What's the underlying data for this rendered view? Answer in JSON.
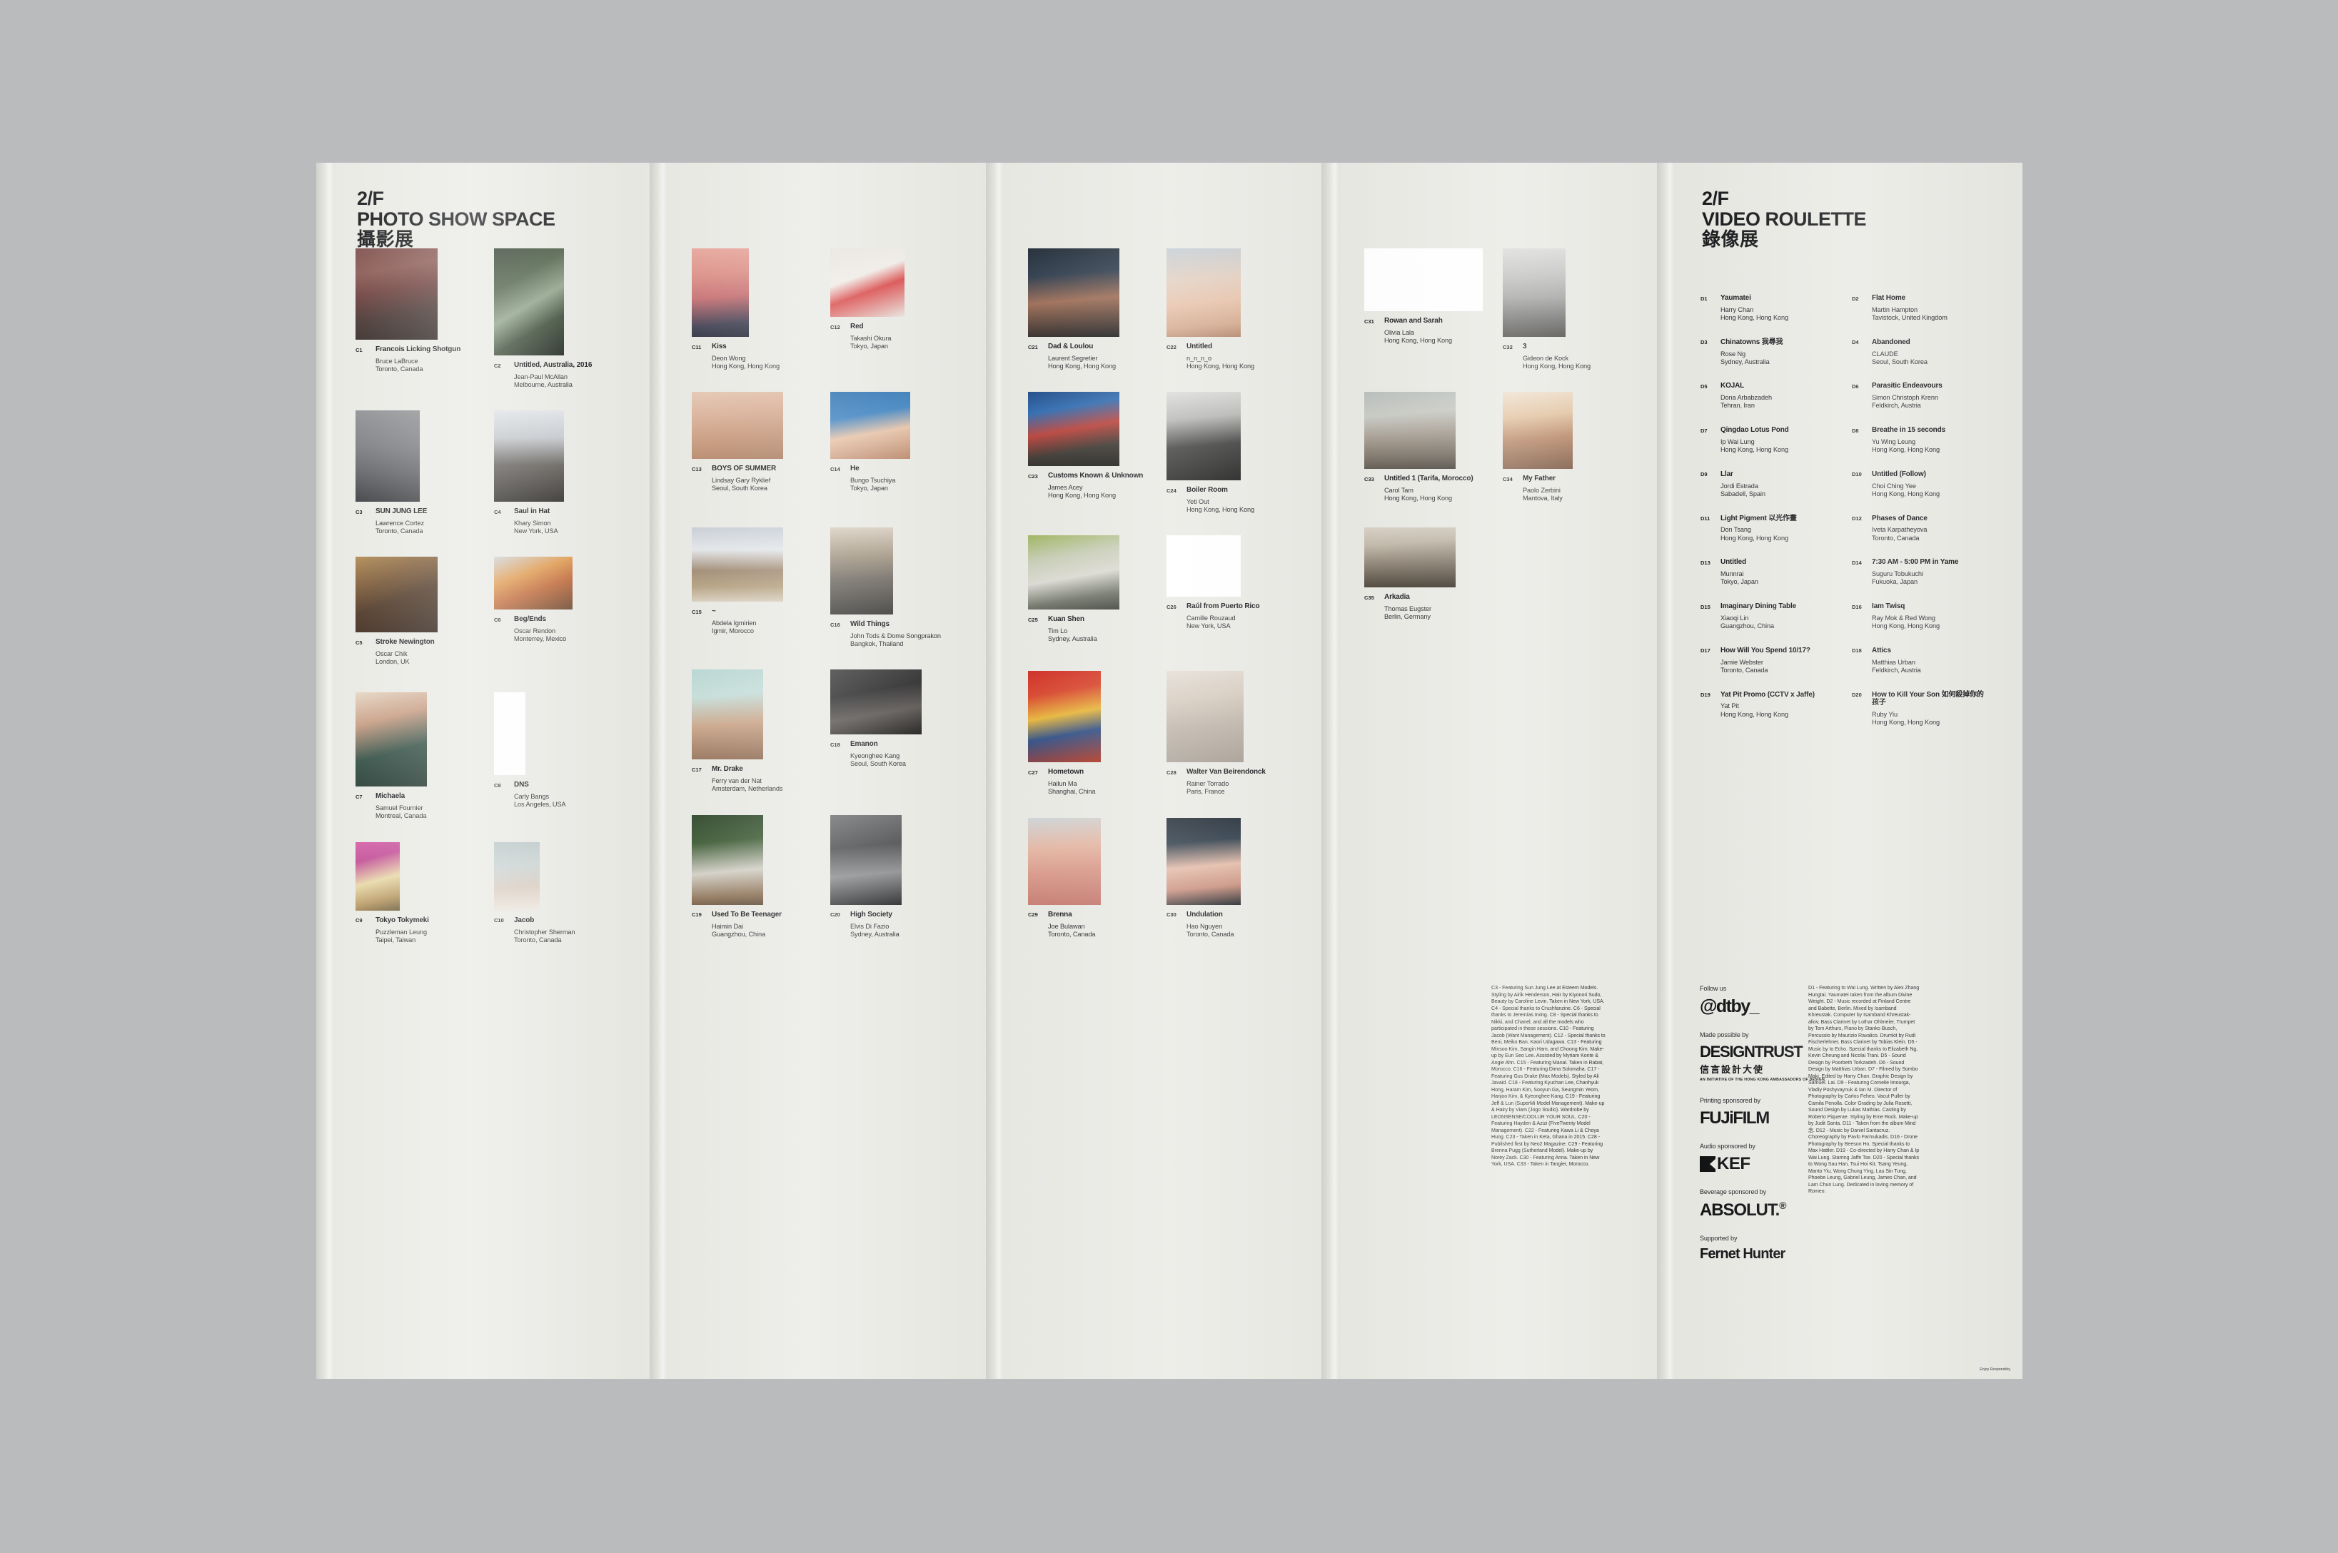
{
  "photo_panel": {
    "floor": "2/F",
    "title": "PHOTO SHOW SPACE",
    "title_cjk": "攝影展"
  },
  "video_panel": {
    "floor": "2/F",
    "title": "VIDEO ROULETTE",
    "title_cjk": "錄像展"
  },
  "photo_works": [
    {
      "code": "C1",
      "title": "Francois Licking Shotgun",
      "artist": "Bruce LaBruce",
      "place": "Toronto, Canada",
      "w": 115,
      "h": 128,
      "img": "linear-gradient(170deg,#7c4e4a 0%,#8a5852 25%,#6d3f3c 45%,#44332f 70%,#2c2422 100%)"
    },
    {
      "code": "C2",
      "title": "Untitled, Australia, 2016",
      "artist": "Jean-Paul McAllan",
      "place": "Melbourne, Australia",
      "w": 98,
      "h": 150,
      "img": "linear-gradient(150deg,#2d3a2a 0%,#4d6047 30%,#8fa289 52%,#3a4a36 72%,#18201a 100%)"
    },
    {
      "code": "C3",
      "title": "SUN JUNG LEE",
      "artist": "Lawrence Cortez",
      "place": "Toronto, Canada",
      "w": 90,
      "h": 128,
      "img": "linear-gradient(180deg,#8e9093 0%,#7a7c80 40%,#5e6064 70%,#3b3d40 100%)"
    },
    {
      "code": "C4",
      "title": "Saul in Hat",
      "artist": "Khary Simon",
      "place": "New York, USA",
      "w": 98,
      "h": 128,
      "img": "linear-gradient(180deg,#dfe2e6 0%,#c2c6ca 30%,#5f5b57 60%,#2a2824 100%)"
    },
    {
      "code": "C5",
      "title": "Stroke Newington",
      "artist": "Oscar Chik",
      "place": "London, UK",
      "w": 115,
      "h": 106,
      "img": "linear-gradient(160deg,#b08a52 0%,#7f5c38 28%,#4c3523 55%,#2b1d14 100%)"
    },
    {
      "code": "C6",
      "title": "Beg/Ends",
      "artist": "Oscar Rendon",
      "place": "Monterrey, Mexico",
      "w": 110,
      "h": 74,
      "img": "linear-gradient(160deg,#cfd3d6 0%,#e09a4e 35%,#c06a3a 60%,#6d4a33 100%)"
    },
    {
      "code": "C7",
      "title": "Michaela",
      "artist": "Samuel Fournier",
      "place": "Montreal, Canada",
      "w": 100,
      "h": 132,
      "img": "linear-gradient(165deg,#e5d7c4 0%,#c79c82 30%,#2f4d43 62%,#1d3029 100%)"
    },
    {
      "code": "C8",
      "title": "DNS",
      "artist": "Carly Bangs",
      "place": "Los Angeles, USA",
      "w": 44,
      "h": 116,
      "img": "linear-gradient(180deg,#ffffff 0%,#ffffff 100%)"
    },
    {
      "code": "C9",
      "title": "Tokyo Tokymeki",
      "artist": "Puzzleman Leung",
      "place": "Taipei, Taiwan",
      "w": 62,
      "h": 96,
      "img": "linear-gradient(165deg,#d45fa8 0%,#c24e96 25%,#e8d9a8 55%,#b89a64 80%,#6b5c3a 100%)"
    },
    {
      "code": "C10",
      "title": "Jacob",
      "artist": "Christopher Sherman",
      "place": "Toronto, Canada",
      "w": 64,
      "h": 96,
      "img": "linear-gradient(175deg,#b9c5c6 0%,#c9d2d2 35%,#d9ccc0 65%,#efe9e2 100%)"
    },
    {
      "code": "C11",
      "title": "Kiss",
      "artist": "Deon Wong",
      "place": "Hong Kong, Hong Kong",
      "w": 80,
      "h": 124,
      "img": "linear-gradient(175deg,#e8a79c 0%,#dc8f86 30%,#c66f72 55%,#3e3f52 85%,#2b2c3a 100%)"
    },
    {
      "code": "C12",
      "title": "Red",
      "artist": "Takashi Okura",
      "place": "Tokyo, Japan",
      "w": 104,
      "h": 96,
      "img": "linear-gradient(160deg,#e7e3dd 0%,#f0ece6 40%,#d94a4a 60%,#e9e5df 100%)"
    },
    {
      "code": "C13",
      "title": "BOYS OF SUMMER",
      "artist": "Lindsay Gary Ryklief",
      "place": "Seoul, South Korea",
      "w": 128,
      "h": 94,
      "img": "linear-gradient(170deg,#e6c9b4 0%,#d9ae95 35%,#c59678 65%,#a87a5e 100%)"
    },
    {
      "code": "C14",
      "title": "He",
      "artist": "Bungo Tsuchiya",
      "place": "Tokyo, Japan",
      "w": 112,
      "h": 94,
      "img": "linear-gradient(170deg,#2b6fae 0%,#3c82c0 35%,#e7c3a8 60%,#b98668 100%)"
    },
    {
      "code": "C15",
      "title": "~",
      "artist": "Abdela Igmirien",
      "place": "Igmir, Morocco",
      "w": 128,
      "h": 104,
      "img": "linear-gradient(180deg,#c8ced5 0%,#e3e6e9 30%,#9f8a72 58%,#b4a07f 80%,#d9cfbe 100%)"
    },
    {
      "code": "C16",
      "title": "Wild Things",
      "artist": "John Tods & Dome Songprakon",
      "place": "Bangkok, Thailand",
      "w": 88,
      "h": 122,
      "img": "linear-gradient(180deg,#d8cec0 0%,#a89b88 30%,#6f6a62 60%,#3b3a38 100%)"
    },
    {
      "code": "C17",
      "title": "Mr. Drake",
      "artist": "Ferry van der Nat",
      "place": "Amsterdam, Netherlands",
      "w": 100,
      "h": 126,
      "img": "linear-gradient(175deg,#b7d6d2 0%,#c5ded9 30%,#caa588 60%,#8e6a52 100%)"
    },
    {
      "code": "C18",
      "title": "Emanon",
      "artist": "Kyeonghee Kang",
      "place": "Seoul, South Korea",
      "w": 128,
      "h": 91,
      "img": "linear-gradient(170deg,#3b3b3c 0%,#2a2a2b 35%,#5a5552 65%,#1a1918 100%)"
    },
    {
      "code": "C19",
      "title": "Used To Be Teenager",
      "artist": "Haimin Dai",
      "place": "Guangzhou, China",
      "w": 100,
      "h": 126,
      "img": "linear-gradient(175deg,#2c4428 0%,#3c5a33 30%,#d3d0c6 62%,#8d7256 88%,#5c4a36 100%)"
    },
    {
      "code": "C20",
      "title": "High Society",
      "artist": "Elvis Di Fazio",
      "place": "Sydney, Australia",
      "w": 100,
      "h": 126,
      "img": "linear-gradient(175deg,#6d6f70 0%,#4a4c4d 35%,#8c8e8f 65%,#222324 100%)"
    },
    {
      "code": "C21",
      "title": "Dad & Loulou",
      "artist": "Laurent Segretier",
      "place": "Hong Kong, Hong Kong",
      "w": 128,
      "h": 124,
      "img": "linear-gradient(175deg,#1f2a36 0%,#2e3c4c 30%,#9d6d56 58%,#4a3a33 85%,#1b1c1e 100%)"
    },
    {
      "code": "C22",
      "title": "Untitled",
      "artist": "n_n_n_o",
      "place": "Hong Kong, Hong Kong",
      "w": 104,
      "h": 124,
      "img": "linear-gradient(175deg,#c3cdd4 0%,#e2cfc0 35%,#e7c3ab 60%,#d4a98e 85%,#b3866c 100%)"
    },
    {
      "code": "C23",
      "title": "Customs Known & Unknown",
      "artist": "James Acey",
      "place": "Hong Kong, Hong Kong",
      "w": 128,
      "h": 104,
      "img": "linear-gradient(170deg,#1e4a86 0%,#2f6bb0 25%,#b9423a 50%,#3a3630 75%,#1a1a18 100%)"
    },
    {
      "code": "C24",
      "title": "Boiler Room",
      "artist": "Yeti Out",
      "place": "Hong Kong, Hong Kong",
      "w": 104,
      "h": 124,
      "img": "linear-gradient(175deg,#dcdcda 0%,#b6b6b4 30%,#3f3f3e 60%,#1d1d1c 100%)"
    },
    {
      "code": "C25",
      "title": "Kuan Shen",
      "artist": "Tim Lo",
      "place": "Sydney, Australia",
      "w": 128,
      "h": 104,
      "img": "linear-gradient(170deg,#9fb45f 0%,#c7cdb6 30%,#dcdad2 55%,#6f7468 80%,#3a3d36 100%)"
    },
    {
      "code": "C26",
      "title": "Raúl from Puerto Rico",
      "artist": "Camille Rouzaud",
      "place": "New York, USA",
      "w": 104,
      "h": 86,
      "img": "linear-gradient(180deg,#ffffff 0%,#ffffff 100%)"
    },
    {
      "code": "C27",
      "title": "Hometown",
      "artist": "Hailun Ma",
      "place": "Shanghai, China",
      "w": 102,
      "h": 128,
      "img": "linear-gradient(170deg,#cf2b22 0%,#d8452c 25%,#e8b63a 48%,#2f4f86 68%,#b1351f 100%)"
    },
    {
      "code": "C28",
      "title": "Walter Van Beirendonck",
      "artist": "Rainer Torrado",
      "place": "Paris, France",
      "w": 108,
      "h": 128,
      "img": "linear-gradient(175deg,#e3dcd3 0%,#d6cbbf 30%,#bdb3a8 60%,#a69d93 100%)"
    },
    {
      "code": "C29",
      "title": "Brenna",
      "artist": "Joe Bulawan",
      "place": "Toronto, Canada",
      "w": 102,
      "h": 122,
      "img": "linear-gradient(175deg,#cfd6d8 0%,#e5b6a2 35%,#d99a8a 60%,#c4766c 100%)"
    },
    {
      "code": "C30",
      "title": "Undulation",
      "artist": "Hao Nguyen",
      "place": "Toronto, Canada",
      "w": 104,
      "h": 122,
      "img": "linear-gradient(175deg,#1e2630 0%,#2c3a47 28%,#e3bba8 55%,#c9907e 78%,#1f262d 100%)"
    },
    {
      "code": "C31",
      "title": "Rowan and Sarah",
      "artist": "Olivia Lala",
      "place": "Hong Kong, Hong Kong",
      "w": 166,
      "h": 88,
      "img": "linear-gradient(180deg,#ffffff 0%,#ffffff 100%)"
    },
    {
      "code": "C32",
      "title": "3",
      "artist": "Gideon de Kock",
      "place": "Hong Kong, Hong Kong",
      "w": 88,
      "h": 124,
      "img": "linear-gradient(180deg,#dcdcdb 0%,#c4c4c3 30%,#a8a8a7 55%,#6e6e6d 85%,#55534f 100%)"
    },
    {
      "code": "C33",
      "title": "Untitled 1 (Tarifa, Morocco)",
      "artist": "Carol Tam",
      "place": "Hong Kong, Hong Kong",
      "w": 128,
      "h": 108,
      "img": "linear-gradient(175deg,#b9bfbd 0%,#c9cac4 30%,#a39a8e 58%,#776f64 82%,#4b463f 100%)"
    },
    {
      "code": "C34",
      "title": "My Father",
      "artist": "Paolo Zerbini",
      "place": "Mantova, Italy",
      "w": 98,
      "h": 108,
      "img": "linear-gradient(175deg,#efe1cf 0%,#e3c4a2 32%,#b98a6a 60%,#7c5b46 100%)"
    },
    {
      "code": "C35",
      "title": "Arkadia",
      "artist": "Thomas Eugster",
      "place": "Berlin, Germany",
      "w": 128,
      "h": 84,
      "img": "linear-gradient(175deg,#d9d1c5 0%,#c1b8a9 28%,#8d8375 56%,#5c5347 82%,#383229 100%)"
    }
  ],
  "video_works": [
    {
      "code": "D1",
      "title": "Yaumatei",
      "artist": "Harry Chan",
      "place": "Hong Kong, Hong Kong"
    },
    {
      "code": "D2",
      "title": "Flat Home",
      "artist": "Martin Hampton",
      "place": "Tavistock, United Kingdom"
    },
    {
      "code": "D3",
      "title": "Chinatowns 我尋我",
      "artist": "Rose Ng",
      "place": "Sydney, Australia"
    },
    {
      "code": "D4",
      "title": "Abandoned",
      "artist": "CLAUDE",
      "place": "Seoul, South Korea"
    },
    {
      "code": "D5",
      "title": "KOJAL",
      "artist": "Dona Arbabzadeh",
      "place": "Tehran, Iran"
    },
    {
      "code": "D6",
      "title": "Parasitic Endeavours",
      "artist": "Simon Christoph Krenn",
      "place": "Feldkirch, Austria"
    },
    {
      "code": "D7",
      "title": "Qingdao Lotus Pond",
      "artist": "Ip Wai Lung",
      "place": "Hong Kong, Hong Kong"
    },
    {
      "code": "D8",
      "title": "Breathe in 15 seconds",
      "artist": "Yu Wing Leung",
      "place": "Hong Kong, Hong Kong"
    },
    {
      "code": "D9",
      "title": "Llar",
      "artist": "Jordi Estrada",
      "place": "Sabadell, Spain"
    },
    {
      "code": "D10",
      "title": "Untitled (Follow)",
      "artist": "Choi Ching Yee",
      "place": "Hong Kong, Hong Kong"
    },
    {
      "code": "D11",
      "title": "Light Pigment 以光作畫",
      "artist": "Don Tsang",
      "place": "Hong Kong, Hong Kong"
    },
    {
      "code": "D12",
      "title": "Phases of Dance",
      "artist": "Iveta Karpatheyova",
      "place": "Toronto, Canada"
    },
    {
      "code": "D13",
      "title": "Untitled",
      "artist": "Munnrai",
      "place": "Tokyo, Japan"
    },
    {
      "code": "D14",
      "title": "7:30 AM - 5:00 PM in Yame",
      "artist": "Suguru Tobukuchi",
      "place": "Fukuoka, Japan"
    },
    {
      "code": "D15",
      "title": "Imaginary Dining Table",
      "artist": "Xiaoqi Lin",
      "place": "Guangzhou, China"
    },
    {
      "code": "D16",
      "title": "Iam Twisq",
      "artist": "Ray Mok & Red Wong",
      "place": "Hong Kong, Hong Kong"
    },
    {
      "code": "D17",
      "title": "How Will You Spend 10/17?",
      "artist": "Jamie Webster",
      "place": "Toronto, Canada"
    },
    {
      "code": "D18",
      "title": "Attics",
      "artist": "Matthias Urban",
      "place": "Feldkirch, Austria"
    },
    {
      "code": "D19",
      "title": "Yat Pit Promo (CCTV x Jaffe)",
      "artist": "Yat Pit",
      "place": "Hong Kong, Hong Kong"
    },
    {
      "code": "D20",
      "title": "How to Kill Your Son 如何殺掉你的孩子",
      "artist": "Ruby Yiu",
      "place": "Hong Kong, Hong Kong"
    }
  ],
  "credits": {
    "photo": "C3 - Featuring Sun Jung Lee at Esteem Models. Styling by Airik Henderson, Hair by Kiyonori Sudo, Beauty by Caroline Levin. Taken in New York, USA. C4 - Special thanks to Crushfanzine.  C6 - Special thanks to Jeremías Irving. C8 - Special thanks to Nikki, and Chanel, and all the models who participated in these sessions. C10 - Featuring Jacob (Want Management). C12 - Special thanks to Beni, Meiko Ban, Kaori Udagawa. C13 - Featuring Minsoo Kim, Sangin Ham, and Choong Kim. Make-up by Eun Seo Lee. Assisted by Myriam Konte & Angie Ahn. C15 - Featuring Manal. Taken in Rabat, Morocco. C16 - Featuring Dima Solomaha. C17 - Featuring Gus Drake (Max Models). Styled by Ali Javaid. C18 - Featuring Kyuchan Lee, Chanhyuk Hong, Haram Kim, Sooyun Ga, Seungmin Yeom, Hanjoo Kim, & Kyeonghee Kang. C19 - Featuring Jeff & Lun (SuperMi Model Management). Make-up & Hairy by Viam (Jogo Studio). Wardrobe by LEONSENSE/COOLUR YOUR SOUL. C20 - Featuring Hayden & Azizi (FiveTwenty Model Management). C22 - Featuring Kawa Li & Choya Hung. C23 - Taken in Keta, Ghana in 2015. C28 - Published first by Neo2 Magazine.  C29 - Featuring Brenna Pugg (Sutherland Model). Make-up by Norey Zack. C30 - Featuring Anna. Taken in New York, USA. C33 - Taken in Tangier, Morocco.",
    "video": "D1 - Featuring to Wai Lung. Written by Alex Zhang Hungtai. Yaumatei taken from the album Divine Weight. D2 - Music recorded at Finland Centre and Babette, Berlin. Mixed by Isamband Khreustak. Computer by Isamband Khreustak-aliov, Bass Clarinet by Lothar Ohlmeier, Trumpet by Tom Arthurs, Piano by Stanko Busch, Percussio by Maurizio Ravalico. Drumkit by Rudi Fischerlehner, Bass Clarinet by Tobias Klein. D5 - Music by Io Echo. Special thanks to Elizabeth Ng, Kevin Cheung and Nicolai Trani. D5 - Sound Design by Poorbeth Torkzadeh. D6 - Sound Design by Matthias Urban. D7 - Filmed by Sombo Maki. Edited by Harry Chan. Graphic Design by Samuel. Lai. D9 - Featuring Cornelie Imourga, Vladiy Poshyvaynuk & Ian M. Director of Photography by Carlos Feheo, Vacut Puller by Camila Penolla. Color Grading by Julia Rosetti, Sound Design by Lukas Mathias. Casting by Roberto Piquerae. Styling by Eme Rock. Make-up by Judit Santa. D11 - Taken from the album Mind 念. D12 - Music by Daniel Santacruz. Choreography by Pavlo Farmukadis. D16 - Drone Photography by Beeson Ho. Special thanks to Max Hattler. D19 - Co-directed by Harry Chan & Ip Wai Lung. Starring Jaffe Tse. D20 - Special thanks to Wong Sau Han, Tsui Hoi Kit, Tsang Yeung, Manto Yiu, Wong Chung Ying, Lau Sin Tung, Phoebe Leung, Gabriel Leung, James Chan, and Lam Chun Lung. Dedicated in loving memory of Romeo."
  },
  "sponsors": {
    "follow_label": "Follow us",
    "follow_handle": "@dtby_",
    "made_label": "Made possible by",
    "made_logo_a": "DESIGN",
    "made_logo_b": "TRUST",
    "made_logo_cjk": "信言設計大使",
    "made_logo_sub": "AN INITIATIVE OF THE HONG KONG AMBASSADORS OF DESIGN",
    "printing_label": "Printing sponsored by",
    "printing_logo": "FUJiFILM",
    "audio_label": "Audio sponsored by",
    "audio_logo": "KEF",
    "beverage_label": "Beverage sponsored by",
    "beverage_logo": "ABSOLUT.",
    "supported_label": "Supported by",
    "supported_logo": "Fernet Hunter"
  },
  "footer": {
    "enjoy": "Enjoy Responsibly."
  }
}
